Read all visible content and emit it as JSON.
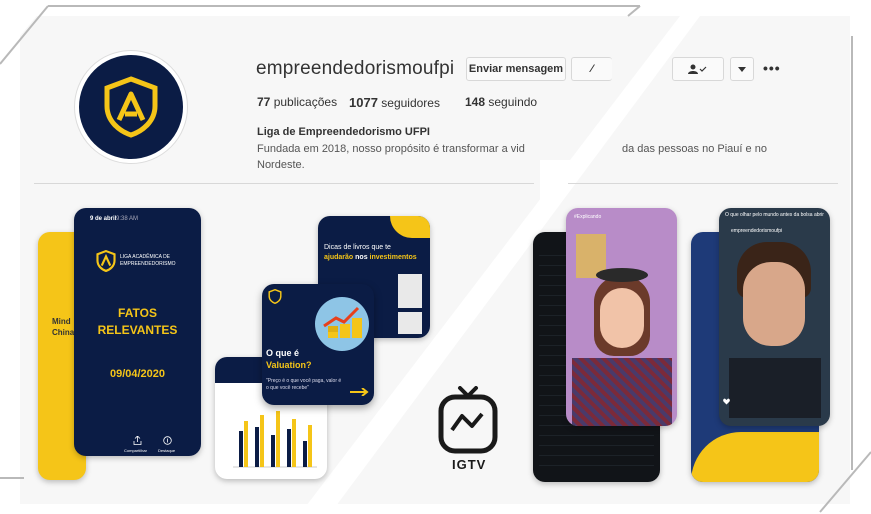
{
  "profile": {
    "username": "empreendedorismoufpi",
    "send_message": "Enviar mensagem",
    "stats": {
      "posts_count": "77",
      "posts_label": "publicações",
      "followers_count": "1077",
      "followers_label": "seguidores",
      "following_count": "148",
      "following_label": "seguindo"
    },
    "bio_name": "Liga de Empreendedorismo UFPI",
    "bio_line1a": "Fundada em 2018, nosso propósito é transformar a vid",
    "bio_line1b": "da das pessoas no Piauí e no",
    "bio_line2": "Nordeste."
  },
  "posts": {
    "story1_date": "9 de abril",
    "story1_time": "9:38 AM",
    "story1_logo": "LIGA ACADÊMICA DE EMPREENDEDORISMO",
    "story1_title_1": "FATOS",
    "story1_title_2": "RELEVANTES",
    "story1_date_big": "09/04/2020",
    "story1_share": "Compartilhar",
    "story1_highlight": "Destaque",
    "left_card_text_1": "Mind",
    "left_card_text_2": "China",
    "books_title": "Dicas de livros que te",
    "books_sub_1": "ajudarão",
    "books_sub_2": "nos",
    "books_sub_3": "investimentos",
    "valuation_q": "O que é",
    "valuation_word": "Valuation?",
    "valuation_quote": "\"Preço é o que você paga, valor é o que você recebe\"",
    "video1_label": "#Explicando",
    "video2_caption": "O que olhar pelo mundo antes da bolsa abrir",
    "video2_user": "empreendedorismoufpi"
  },
  "igtv_label": "IGTV",
  "colors": {
    "navy": "#0b1c45",
    "yellow": "#f5c518",
    "panel": "#f7f7f7"
  },
  "icons": [
    "shield-logo-icon",
    "user-check-icon",
    "chevron-down-icon",
    "more-icon",
    "igtv-icon",
    "share-icon",
    "heart-icon"
  ]
}
